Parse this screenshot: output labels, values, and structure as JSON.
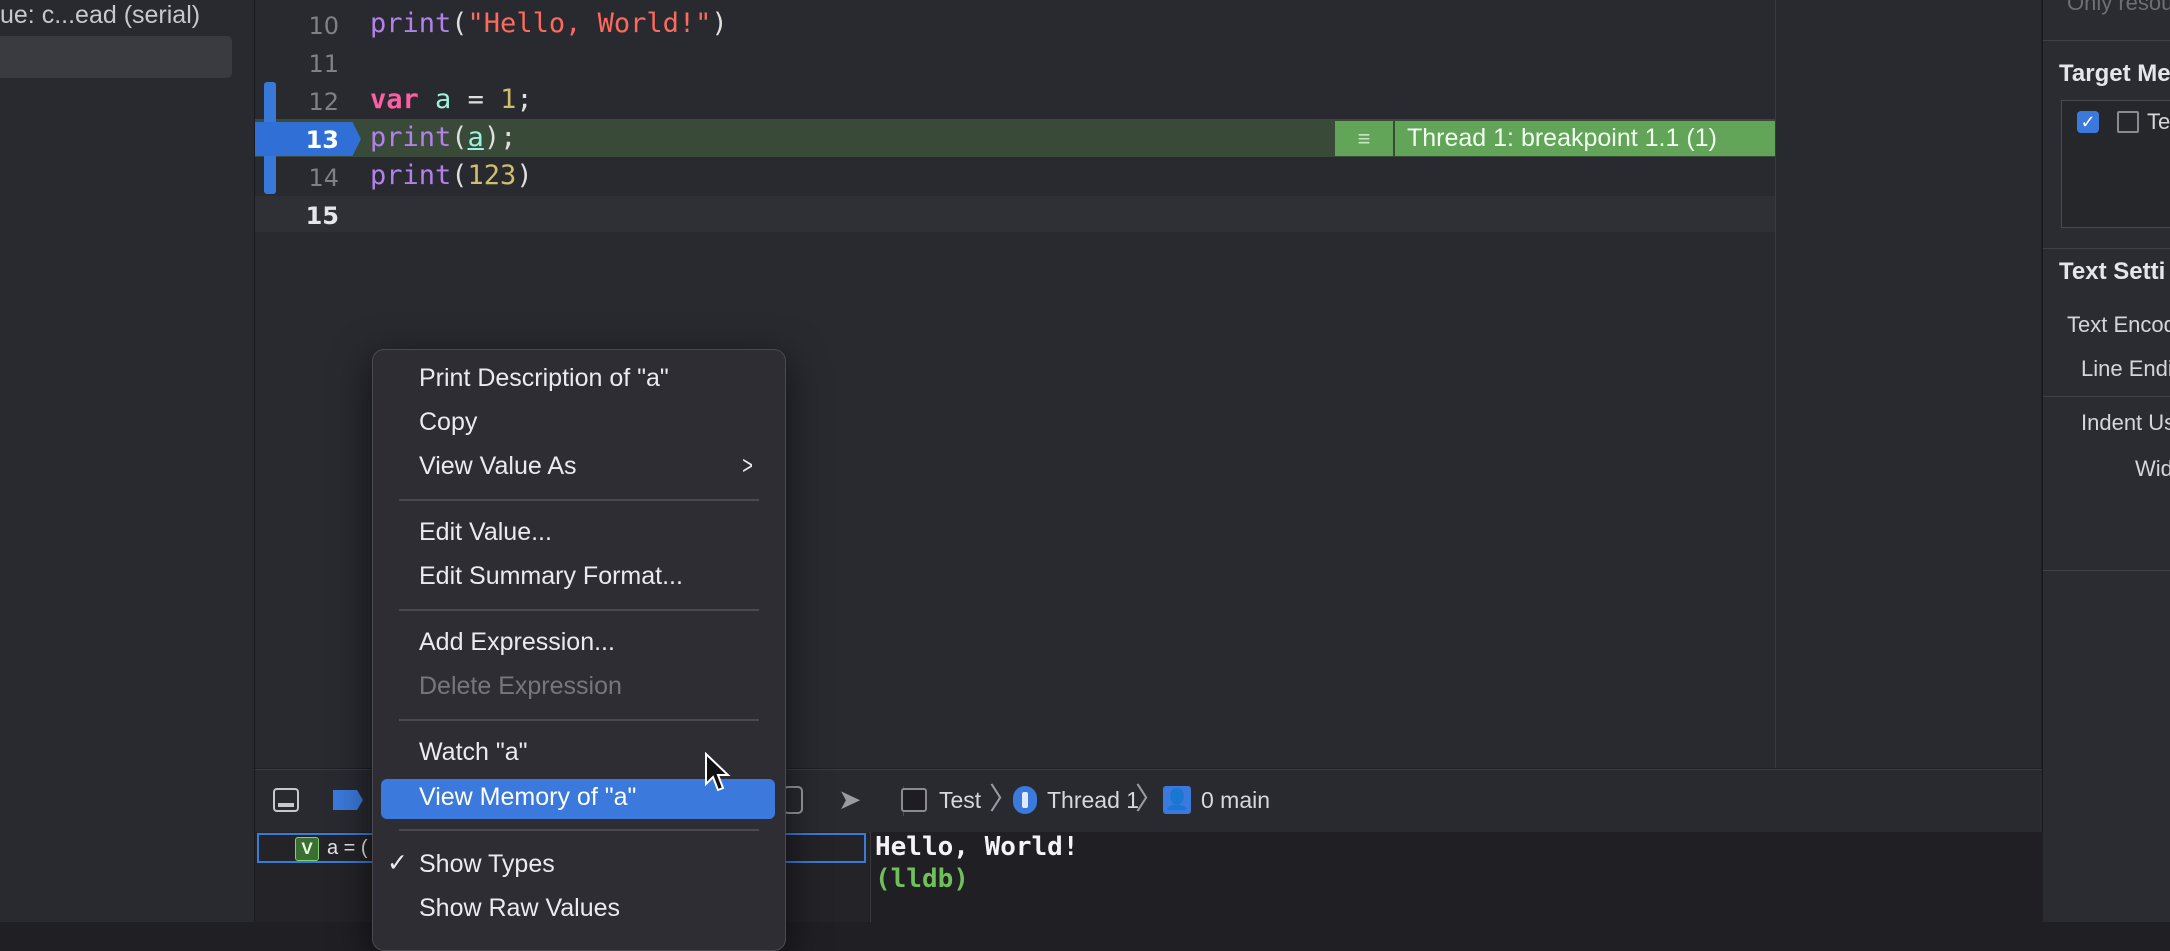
{
  "navigator": {
    "queue_text": "ue: c...ead (serial)"
  },
  "editor": {
    "lines": [
      {
        "num": "10",
        "code": [
          {
            "t": "print",
            "c": "fn"
          },
          {
            "t": "(",
            "c": ""
          },
          {
            "t": "\"Hello, World!\"",
            "c": "str"
          },
          {
            "t": ")",
            "c": ""
          }
        ]
      },
      {
        "num": "11",
        "code": []
      },
      {
        "num": "12",
        "code": [
          {
            "t": "var",
            "c": "kw"
          },
          {
            "t": " ",
            "c": ""
          },
          {
            "t": "a",
            "c": "var"
          },
          {
            "t": " = ",
            "c": ""
          },
          {
            "t": "1",
            "c": "num"
          },
          {
            "t": ";",
            "c": ""
          }
        ]
      },
      {
        "num": "13",
        "code": [
          {
            "t": "print",
            "c": "fn"
          },
          {
            "t": "(",
            "c": ""
          },
          {
            "t": "a",
            "c": "var"
          },
          {
            "t": ");",
            "c": ""
          }
        ]
      },
      {
        "num": "14",
        "code": [
          {
            "t": "print",
            "c": "fn"
          },
          {
            "t": "(",
            "c": ""
          },
          {
            "t": "123",
            "c": "num"
          },
          {
            "t": ")",
            "c": ""
          }
        ]
      },
      {
        "num": "15",
        "code": []
      }
    ],
    "breakpoint_banner": "Thread 1: breakpoint 1.1 (1)",
    "banner_icon": "list-icon"
  },
  "inspector": {
    "top_clipped": "Only resou",
    "target_membership_title": "Target Me",
    "target_item": "Te",
    "text_settings_title": "Text Setti",
    "text_encoding": "Text Encod",
    "line_endings": "Line Endi",
    "indent_using": "Indent Us",
    "widths": "Wid"
  },
  "debug_bar": {
    "path_test": "Test",
    "path_thread": "Thread 1",
    "path_frame": "0 main"
  },
  "variables": {
    "row_text": "a = ("
  },
  "console": {
    "output": "Hello, World!",
    "prompt": "(lldb)"
  },
  "context_menu": {
    "items": [
      "Print Description of \"a\"",
      "Copy",
      "View Value As",
      "Edit Value...",
      "Edit Summary Format...",
      "Add Expression...",
      "Delete Expression",
      "Watch \"a\"",
      "View Memory of \"a\"",
      "Show Types",
      "Show Raw Values"
    ],
    "checkmark": "✓",
    "submenu_arrow": ">"
  },
  "colors": {
    "accent": "#3b79dc",
    "breakpoint_green": "#62a458",
    "console_prompt": "#6fbf5a"
  }
}
